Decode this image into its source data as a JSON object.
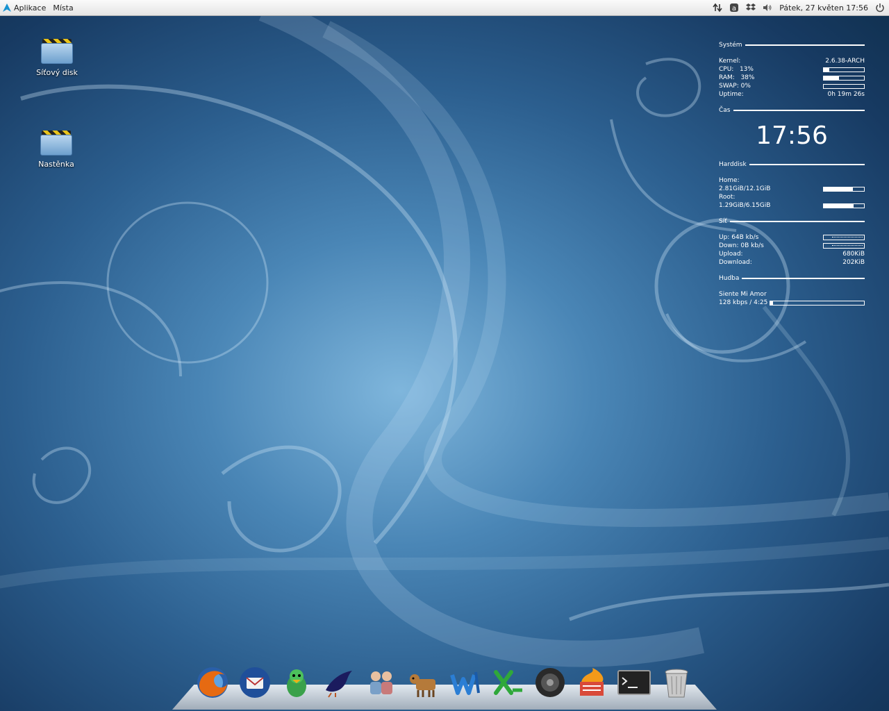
{
  "panel": {
    "menu_apps": "Aplikace",
    "menu_places": "Místa",
    "clock": "Pátek, 27 květen 17:56"
  },
  "desktop_icons": [
    {
      "label": "Síťový disk",
      "icon": "folder-icon"
    },
    {
      "label": "Nastěnka",
      "icon": "folder-icon"
    }
  ],
  "conky": {
    "system": {
      "title": "Systém",
      "kernel_label": "Kernel:",
      "kernel_value": "2.6.38-ARCH",
      "cpu_label": "CPU:",
      "cpu_value": "13%",
      "cpu_fraction": 0.13,
      "ram_label": "RAM:",
      "ram_value": "38%",
      "ram_fraction": 0.38,
      "swap_label": "SWAP:",
      "swap_value": "0%",
      "swap_fraction": 0,
      "uptime_label": "Uptime:",
      "uptime_value": "0h 19m 26s"
    },
    "time": {
      "title": "Čas",
      "clock": "17:56"
    },
    "disk": {
      "title": "Harddisk",
      "home_label": "Home:",
      "home_value": "2.81GiB/12.1GiB",
      "home_fraction": 0.72,
      "root_label": "Root:",
      "root_value": "1.29GiB/6.15GiB",
      "root_fraction": 0.74
    },
    "net": {
      "title": "Síť",
      "up_label": "Up: 64B kb/s",
      "down_label": "Down: 0B kb/s",
      "upload_label": "Upload:",
      "upload_value": "680KiB",
      "download_label": "Download:",
      "download_value": "202KiB"
    },
    "music": {
      "title": "Hudba",
      "song": "Siente Mi Amor",
      "info": "128 kbps / 4:25",
      "progress_fraction": 0.03
    }
  },
  "dock_items": [
    {
      "icon": "firefox-icon"
    },
    {
      "icon": "thunderbird-icon"
    },
    {
      "icon": "pidgin-icon"
    },
    {
      "icon": "crow-icon"
    },
    {
      "icon": "people-icon"
    },
    {
      "icon": "cow-icon"
    },
    {
      "icon": "writer-icon"
    },
    {
      "icon": "calc-icon"
    },
    {
      "icon": "speaker-icon"
    },
    {
      "icon": "burner-icon"
    },
    {
      "icon": "terminal-icon"
    },
    {
      "icon": "trash-icon"
    }
  ],
  "colors": {
    "panel": "#eeeeee",
    "wallpaper_light": "#7fb6dc",
    "wallpaper_dark": "#173a62"
  }
}
